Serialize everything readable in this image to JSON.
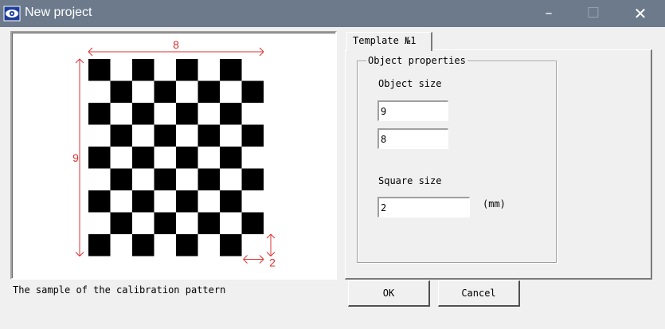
{
  "window": {
    "title": "New project",
    "icon": "eye-camera-icon",
    "minimize_glyph": "–",
    "maximize_glyph": "☐",
    "close_glyph": "✕"
  },
  "preview": {
    "caption": "The sample of the calibration pattern",
    "pattern": {
      "rows": 9,
      "cols": 8,
      "width_label": "8",
      "height_label": "9",
      "square_label": "2"
    },
    "colors": {
      "dimension": "#e03030",
      "square": "#000000",
      "background": "#ffffff"
    }
  },
  "tabs": [
    {
      "label": "Template №1",
      "active": true
    }
  ],
  "group": {
    "legend": "Object properties",
    "object_size_label": "Object size",
    "object_size_rows": "9",
    "object_size_cols": "8",
    "square_size_label": "Square size",
    "square_size_value": "2",
    "square_size_unit": "(mm)"
  },
  "buttons": {
    "ok": "OK",
    "cancel": "Cancel"
  },
  "colors": {
    "titlebar": "#6c7a8c",
    "face": "#f0f0f0"
  }
}
